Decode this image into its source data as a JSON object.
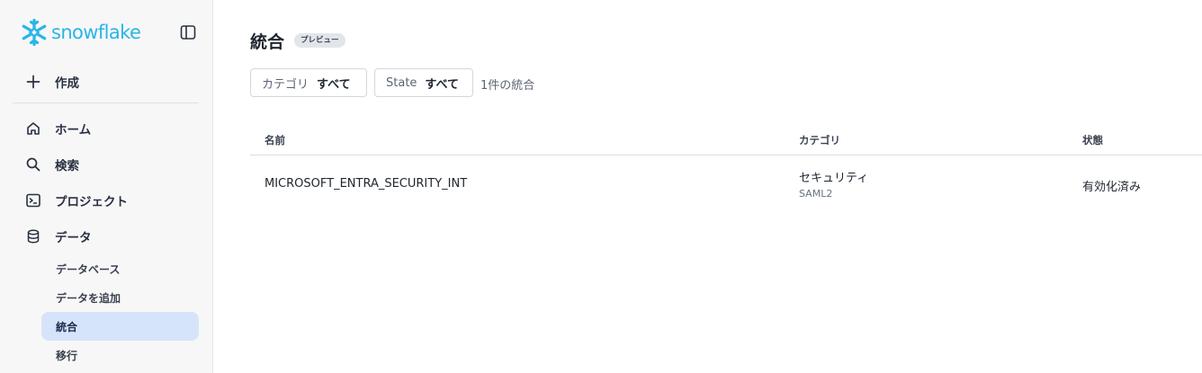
{
  "sidebar": {
    "logo_text": "snowflake",
    "create_label": "作成",
    "nav": {
      "home": "ホーム",
      "search": "検索",
      "projects": "プロジェクト",
      "data": "データ"
    },
    "sub": {
      "databases": "データベース",
      "add_data": "データを追加",
      "integrations": "統合",
      "migration": "移行"
    }
  },
  "main": {
    "title": "統合",
    "badge": "プレビュー",
    "filters": {
      "category_label": "カテゴリ",
      "category_value": "すべて",
      "state_label": "State",
      "state_value": "すべて"
    },
    "count_text": "1件の統合",
    "table": {
      "headers": {
        "name": "名前",
        "category": "カテゴリ",
        "status": "状態"
      },
      "rows": [
        {
          "name": "MICROSOFT_ENTRA_SECURITY_INT",
          "category": "セキュリティ",
          "subcategory": "SAML2",
          "status": "有効化済み"
        }
      ]
    }
  },
  "colors": {
    "brand": "#29b5e8",
    "active_bg": "#d6e4fb",
    "sidebar_bg": "#f7f7f8"
  }
}
